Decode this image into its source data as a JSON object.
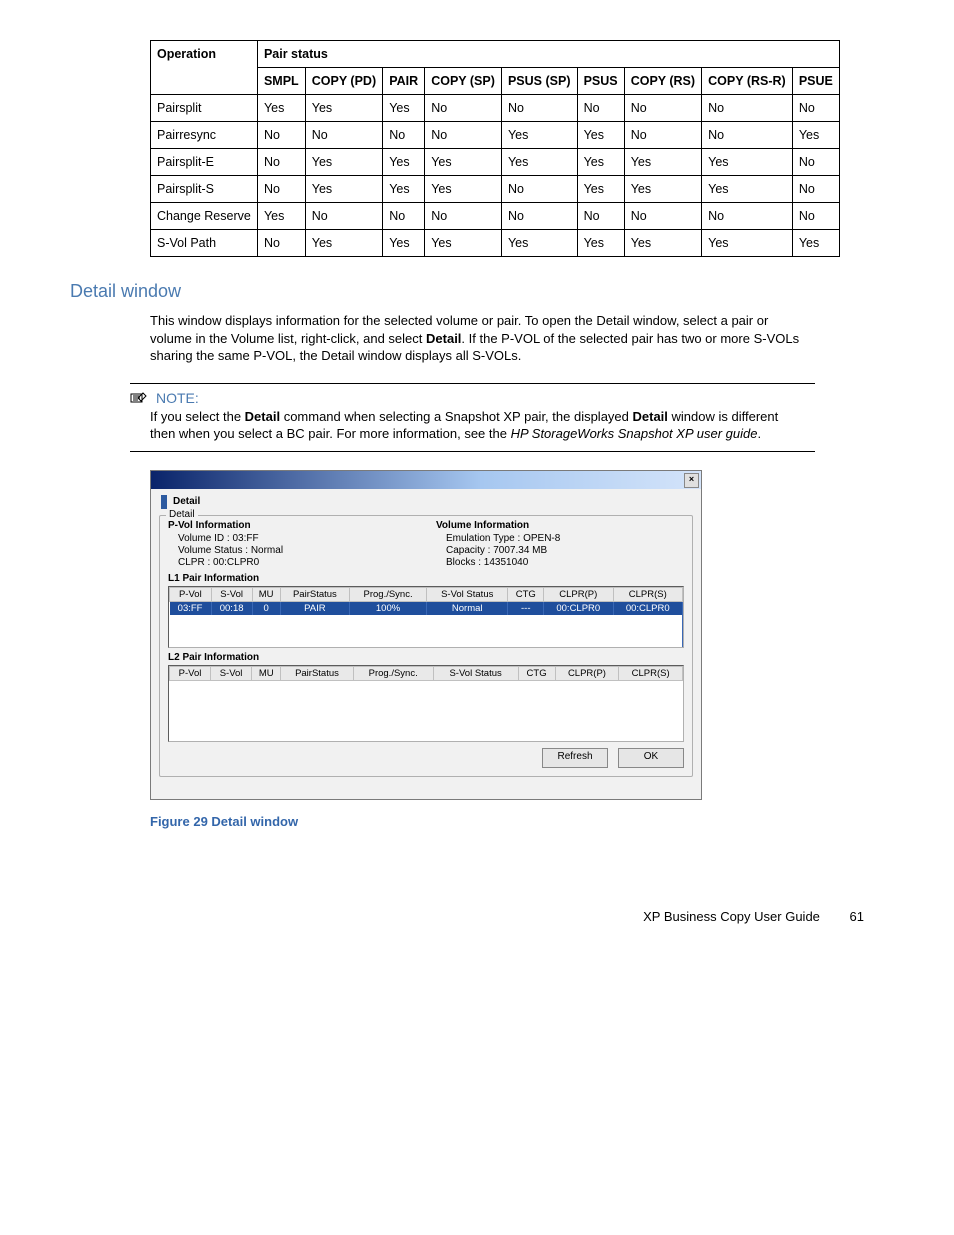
{
  "table": {
    "col_operation": "Operation",
    "col_pairstatus": "Pair status",
    "sub_headers": [
      "SMPL",
      "COPY (PD)",
      "PAIR",
      "COPY (SP)",
      "PSUS (SP)",
      "PSUS",
      "COPY (RS)",
      "COPY (RS-R)",
      "PSUE"
    ],
    "rows": [
      {
        "op": "Pairsplit",
        "cells": [
          "Yes",
          "Yes",
          "Yes",
          "No",
          "No",
          "No",
          "No",
          "No",
          "No"
        ]
      },
      {
        "op": "Pairresync",
        "cells": [
          "No",
          "No",
          "No",
          "No",
          "Yes",
          "Yes",
          "No",
          "No",
          "Yes"
        ]
      },
      {
        "op": "Pairsplit-E",
        "cells": [
          "No",
          "Yes",
          "Yes",
          "Yes",
          "Yes",
          "Yes",
          "Yes",
          "Yes",
          "No"
        ]
      },
      {
        "op": "Pairsplit-S",
        "cells": [
          "No",
          "Yes",
          "Yes",
          "Yes",
          "No",
          "Yes",
          "Yes",
          "Yes",
          "No"
        ]
      },
      {
        "op": "Change Reserve",
        "cells": [
          "Yes",
          "No",
          "No",
          "No",
          "No",
          "No",
          "No",
          "No",
          "No"
        ]
      },
      {
        "op": "S-Vol Path",
        "cells": [
          "No",
          "Yes",
          "Yes",
          "Yes",
          "Yes",
          "Yes",
          "Yes",
          "Yes",
          "Yes"
        ]
      }
    ]
  },
  "section_title": "Detail window",
  "section_body_1": "This window displays information for the selected volume or pair. To open the Detail window, select a pair or volume in the Volume list, right-click, and select ",
  "section_body_bold": "Detail",
  "section_body_2": ". If the P-VOL of the selected pair has two or more S-VOLs sharing the same P-VOL, the Detail window displays all S-VOLs.",
  "note_label": "NOTE:",
  "note_t1": "If you select the ",
  "note_b1": "Detail",
  "note_t2": " command when selecting a Snapshot XP pair, the displayed ",
  "note_b2": "Detail",
  "note_t3": " window is different then when you select a BC pair. For more information, see the ",
  "note_i1": "HP StorageWorks Snapshot XP user guide",
  "note_t4": ".",
  "dlg": {
    "title": "Detail",
    "fieldset_legend": "Detail",
    "pvol_title": "P-Vol Information",
    "pvol_lines": [
      "Volume ID : 03:FF",
      "Volume Status : Normal",
      "CLPR : 00:CLPR0"
    ],
    "vol_title": "Volume Information",
    "vol_lines": [
      "Emulation Type : OPEN-8",
      "Capacity : 7007.34 MB",
      "Blocks : 14351040"
    ],
    "l1_title": "L1 Pair Information",
    "pair_headers": [
      "P-Vol",
      "S-Vol",
      "MU",
      "PairStatus",
      "Prog./Sync.",
      "S-Vol Status",
      "CTG",
      "CLPR(P)",
      "CLPR(S)"
    ],
    "l1_row": [
      "03:FF",
      "00:18",
      "0",
      "PAIR",
      "100%",
      "Normal",
      "---",
      "00:CLPR0",
      "00:CLPR0"
    ],
    "l2_title": "L2 Pair Information",
    "btn_refresh": "Refresh",
    "btn_ok": "OK"
  },
  "figure_caption": "Figure 29 Detail window",
  "footer_text": "XP Business Copy User Guide",
  "footer_page": "61"
}
